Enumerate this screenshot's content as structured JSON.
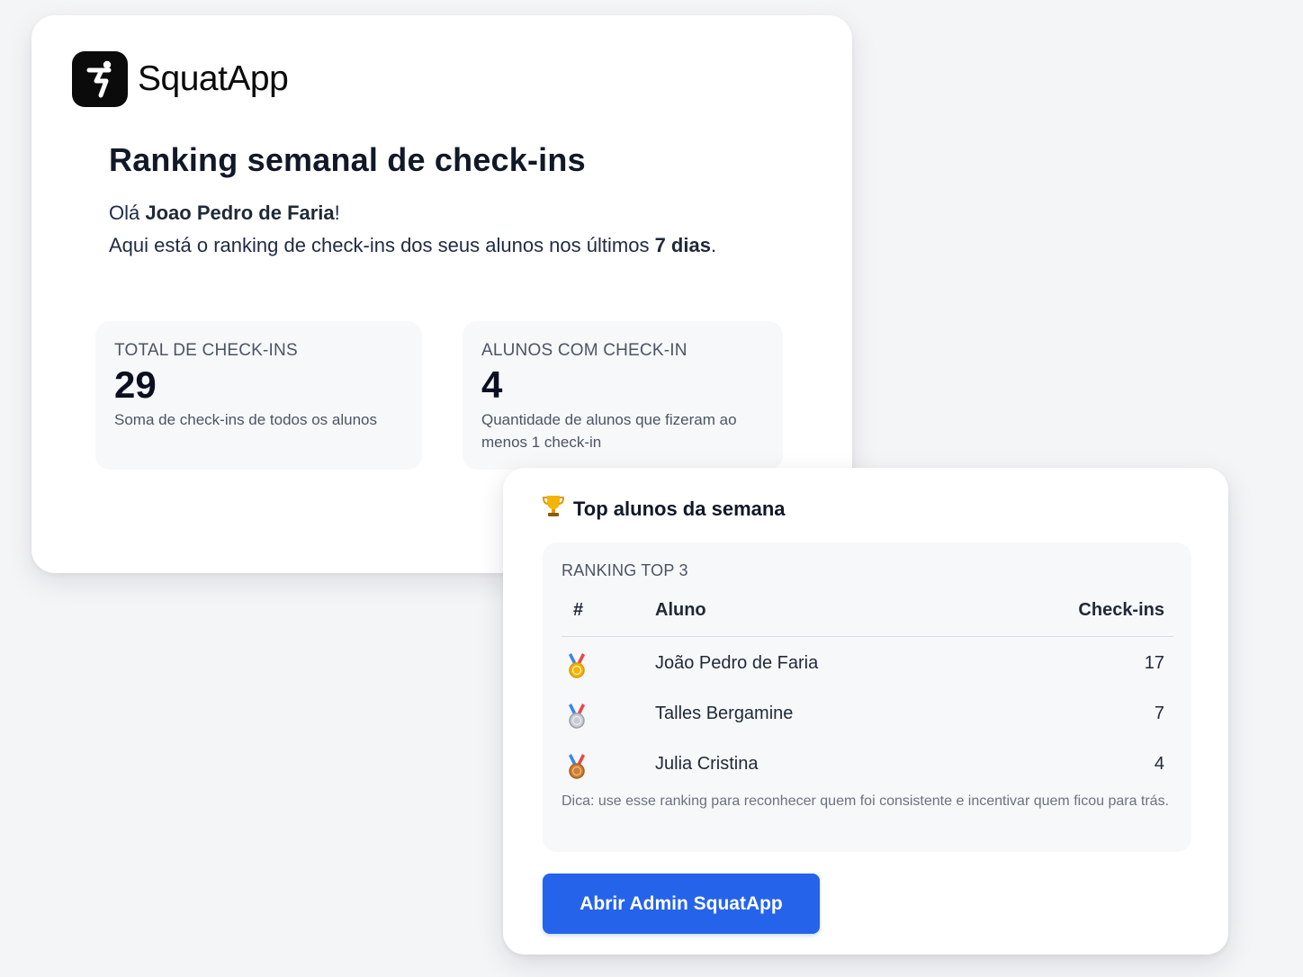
{
  "brand": {
    "name": "SquatApp",
    "logo_icon": "squat-figure-icon"
  },
  "email": {
    "title": "Ranking semanal de check-ins",
    "greeting_prefix": "Olá ",
    "user_name": "Joao Pedro de Faria",
    "greeting_suffix": "!",
    "intro_text": "Aqui está o ranking de check-ins dos seus alunos nos últimos ",
    "days": "7 dias",
    "intro_end": "."
  },
  "stats": [
    {
      "label": "TOTAL DE CHECK-INS",
      "value": "29",
      "description": "Soma de check-ins de todos os alunos"
    },
    {
      "label": "ALUNOS COM CHECK-IN",
      "value": "4",
      "description": "Quantidade de alunos que fizeram ao menos 1 check-in"
    }
  ],
  "top": {
    "icon": "trophy-icon",
    "title": "Top alunos da semana",
    "ranking_label": "RANKING TOP 3",
    "columns": [
      "#",
      "Aluno",
      "Check-ins"
    ],
    "rows": [
      {
        "medal": "gold-medal-icon",
        "name": "João Pedro de Faria",
        "checkins": "17"
      },
      {
        "medal": "silver-medal-icon",
        "name": "Talles Bergamine",
        "checkins": "7"
      },
      {
        "medal": "bronze-medal-icon",
        "name": "Julia Cristina",
        "checkins": "4"
      }
    ],
    "tip": "Dica: use esse ranking para reconhecer quem foi consistente e incentivar quem ficou para trás.",
    "button_label": "Abrir Admin SquatApp"
  },
  "colors": {
    "background": "#f4f5f7",
    "accent": "#2563eb",
    "logo_bg": "#0b0b0c",
    "gold": "#f4b400",
    "silver": "#b8bec7",
    "bronze": "#cd7f32"
  }
}
